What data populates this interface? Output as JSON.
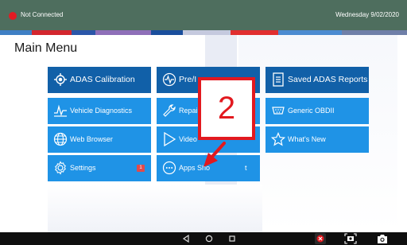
{
  "status": {
    "connection": "Not Connected",
    "date": "Wednesday 9/02/2020",
    "connection_color": "#e31b23"
  },
  "main": {
    "title": "Main Menu",
    "tiles": [
      {
        "label": "ADAS Calibration",
        "icon": "target-icon"
      },
      {
        "label": "Pre/I",
        "icon": "pulse-icon"
      },
      {
        "label": "Saved ADAS Reports",
        "icon": "report-icon"
      },
      {
        "label": "Vehicle Diagnostics",
        "icon": "waveform-icon"
      },
      {
        "label": "Repai",
        "icon": "wrench-icon"
      },
      {
        "label": "Generic OBDII",
        "icon": "obd-connector-icon"
      },
      {
        "label": "Web Browser",
        "icon": "globe-icon"
      },
      {
        "label": "Video",
        "icon": "play-icon"
      },
      {
        "label": "What's New",
        "icon": "star-icon"
      },
      {
        "label": "Settings",
        "icon": "gear-icon",
        "badge": "1"
      },
      {
        "label": "Apps Sho",
        "label_end": "t",
        "icon": "apps-icon"
      }
    ]
  },
  "annotation": {
    "step_number": "2",
    "color": "#e2191f"
  },
  "navbar": {
    "icons": [
      "back-icon",
      "home-icon",
      "recents-icon",
      "close-badge-icon",
      "screenshot-icon",
      "camera-icon"
    ]
  },
  "colors": {
    "tile_blue": "#1f93e6",
    "tile_dark_blue": "#1160a8",
    "status_bar": "#4e6e5e"
  }
}
